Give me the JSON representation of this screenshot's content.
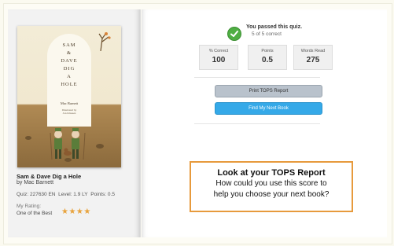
{
  "cover": {
    "title_lines": [
      "SAM",
      "&",
      "DAVE",
      "DIG",
      "A",
      "HOLE"
    ],
    "author": "Mac Barnett",
    "illustrator_line": "Illustrated by",
    "illustrator": "Jon Klassen"
  },
  "book": {
    "title": "Sam & Dave Dig a Hole",
    "author": "by Mac Barnett",
    "quiz": "Quiz: 227630 EN",
    "level": "Level: 1.9 LY",
    "points": "Points: 0.5",
    "rating_label": "My Rating:",
    "rating_text": "One of the Best",
    "stars": "★★★★"
  },
  "result": {
    "title": "You passed this quiz.",
    "subtitle": "5 of 5 correct",
    "icon": "check-icon",
    "accent": "#4fae43"
  },
  "stats": [
    {
      "label": "% Correct",
      "value": "100"
    },
    {
      "label": "Points",
      "value": "0.5"
    },
    {
      "label": "Words Read",
      "value": "275"
    }
  ],
  "buttons": {
    "print_label": "Print TOPS Report",
    "find_label": "Find My Next Book"
  },
  "callout": {
    "title": "Look at your TOPS Report",
    "body_line1": "How could you use this score to",
    "body_line2": "help you choose your next book?",
    "border_color": "#e79a3c"
  }
}
